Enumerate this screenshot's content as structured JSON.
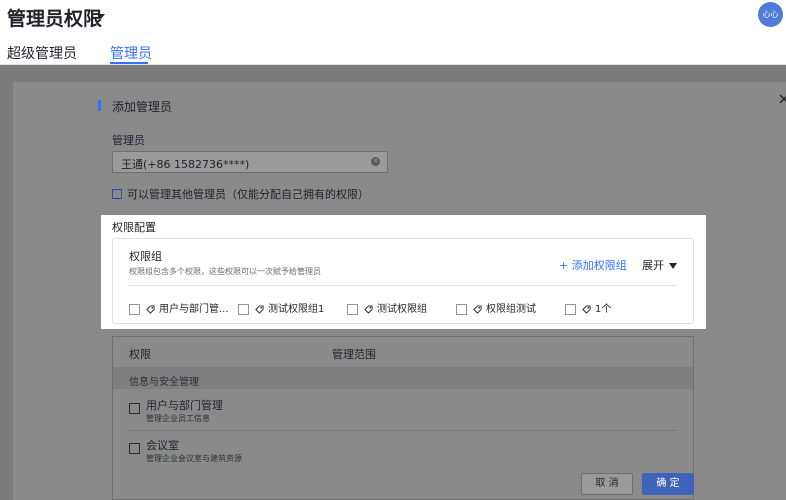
{
  "header": {
    "title": "管理员权限",
    "avatar_text": "心心",
    "tabs": [
      {
        "label": "超级管理员",
        "active": false
      },
      {
        "label": "管理员",
        "active": true
      }
    ]
  },
  "dialog": {
    "section_title": "添加管理员",
    "admin_field": {
      "label": "管理员",
      "value": "王通(+86 1582736****)"
    },
    "manage_others_label": "可以管理其他管理员（仅能分配自己拥有的权限）",
    "permission_config": {
      "label": "权限配置",
      "group_title": "权限组",
      "group_desc": "权限组包含多个权限，这些权限可以一次赋予给管理员",
      "add_group_label": "+ 添加权限组",
      "expand_label": "展开",
      "groups": [
        {
          "label": "用户与部门管..."
        },
        {
          "label": "测试权限组1"
        },
        {
          "label": "测试权限组"
        },
        {
          "label": "权限组测试"
        },
        {
          "label": "1个"
        }
      ]
    },
    "table": {
      "headers": [
        "权限",
        "管理范围"
      ],
      "category": "信息与安全管理",
      "rows": [
        {
          "title": "用户与部门管理",
          "desc": "管理企业员工信息"
        },
        {
          "title": "会议室",
          "desc": "管理企业会议室与建筑资源"
        }
      ]
    },
    "buttons": {
      "cancel": "取 消",
      "confirm": "确 定"
    }
  },
  "colors": {
    "accent": "#3370ff",
    "overlay": "#7b7b7b",
    "confirm_dimmed": "#3f63b8"
  }
}
